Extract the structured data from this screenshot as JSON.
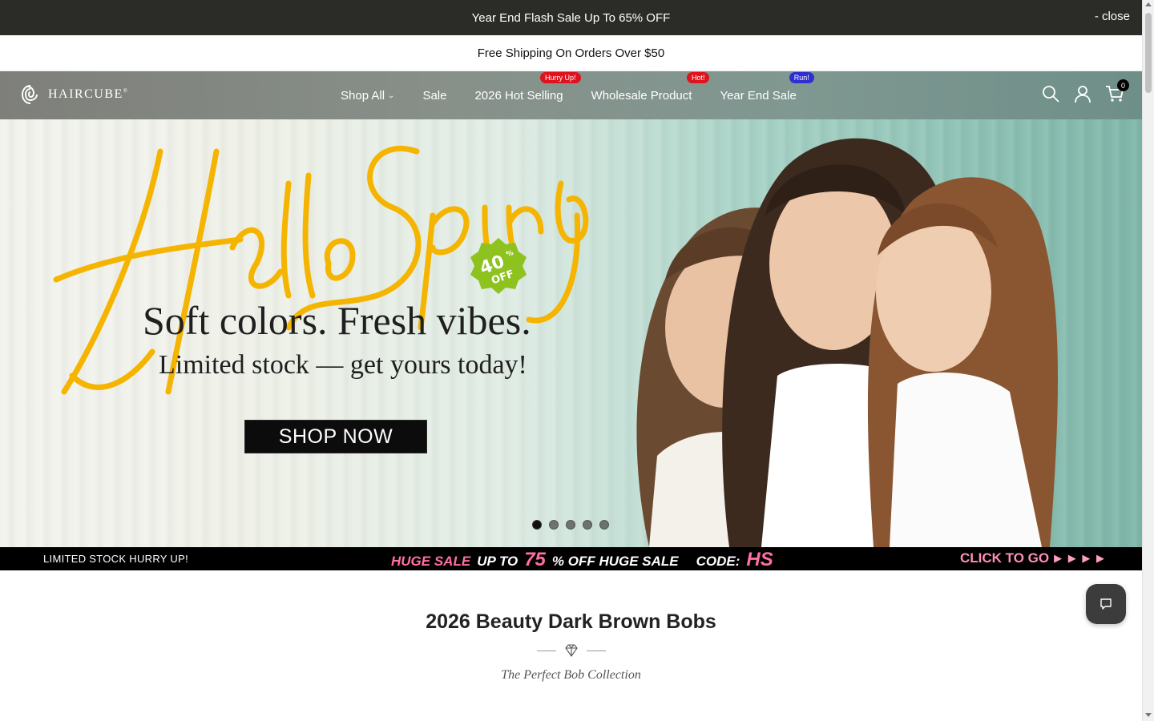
{
  "announcement": {
    "text": "Year End Flash Sale Up To 65% OFF",
    "close_label": "- close"
  },
  "shipping": {
    "text": "Free Shipping On Orders Over $50"
  },
  "header": {
    "logo_text": "HAIRCUBE",
    "logo_mark": "®",
    "nav": [
      {
        "label": "Shop All",
        "has_dropdown": true
      },
      {
        "label": "Sale"
      },
      {
        "label": "2026 Hot Selling",
        "badge": "Hurry Up!"
      },
      {
        "label": "Wholesale Product",
        "badge": "Hot!"
      },
      {
        "label": "Year End Sale",
        "badge": "Run!"
      }
    ],
    "cart_count": "0",
    "icons": [
      "search-icon",
      "account-icon",
      "cart-icon"
    ]
  },
  "hero": {
    "script_text": "Hello Spring",
    "discount_value": "40",
    "discount_unit": "%",
    "discount_off": "OFF",
    "headline": "Soft colors. Fresh vibes.",
    "subline": "Limited stock — get yours today!",
    "cta": "SHOP NOW",
    "slides": 5,
    "active_slide": 1
  },
  "promo_strip": {
    "left": "LIMITED STOCK HURRY UP!",
    "huge_sale": "HUGE SALE",
    "up_to": "UP TO",
    "percent": "75",
    "off_text": "% OFF HUGE SALE",
    "code_label": "CODE:",
    "code": "HS",
    "cta": "CLICK TO GO",
    "arrows": "▶ ▶ ▶ ▶"
  },
  "section": {
    "title": "2026 Beauty Dark Brown Bobs",
    "subtitle": "The Perfect Bob Collection"
  },
  "colors": {
    "announce_bg": "#2b2b28",
    "badge_red": "#e0121d",
    "badge_blue": "#2f2fcf",
    "script_yellow": "#f5b400",
    "discount_green": "#8dc21f",
    "promo_pink": "#ff6fa0"
  }
}
